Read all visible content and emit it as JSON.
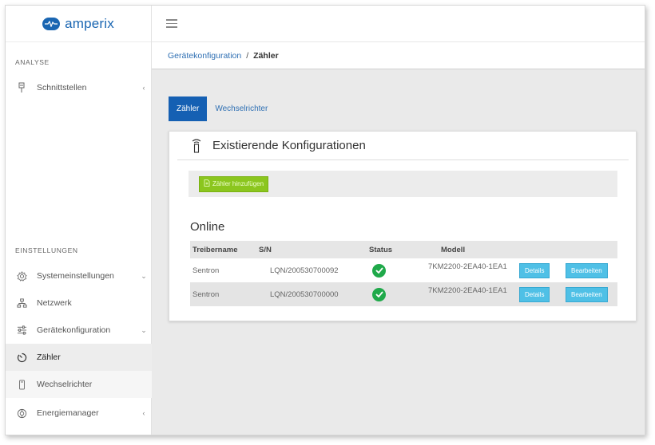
{
  "brand": {
    "name": "amperix"
  },
  "sidebar": {
    "analyse_label": "ANALYSE",
    "settings_label": "EINSTELLUNGEN",
    "items": [
      {
        "label": "Schnittstellen",
        "icon": "plug-icon",
        "chevron": "‹"
      },
      {
        "label": "Systemeinstellungen",
        "icon": "gear-icon",
        "chevron": "⌄"
      },
      {
        "label": "Netzwerk",
        "icon": "network-icon"
      },
      {
        "label": "Gerätekonfiguration",
        "icon": "sliders-icon",
        "chevron": "⌄"
      },
      {
        "label": "Zähler",
        "icon": "meter-icon"
      },
      {
        "label": "Wechselrichter",
        "icon": "inverter-icon"
      },
      {
        "label": "Energiemanager",
        "icon": "energy-manager-icon",
        "chevron": "‹"
      }
    ]
  },
  "breadcrumb": {
    "parent": "Gerätekonfiguration",
    "separator": "/",
    "current": "Zähler"
  },
  "tabs": [
    {
      "label": "Zähler",
      "active": true
    },
    {
      "label": "Wechselrichter",
      "active": false
    }
  ],
  "card": {
    "title": "Existierende Konfigurationen",
    "add_button_label": "Zähler hinzufügen",
    "section_title": "Online",
    "table": {
      "columns": [
        "Treibername",
        "S/N",
        "Status",
        "Modell"
      ],
      "rows": [
        {
          "driver": "Sentron",
          "sn": "LQN/200530700092",
          "status": "ok",
          "model": "7KM2200-2EA40-1EA1",
          "details": "Details",
          "edit": "Bearbeiten"
        },
        {
          "driver": "Sentron",
          "sn": "LQN/200530700000",
          "status": "ok",
          "model": "7KM2200-2EA40-1EA1",
          "details": "Details",
          "edit": "Bearbeiten"
        }
      ]
    }
  },
  "colors": {
    "primary": "#1560b3",
    "success": "#1fa94a",
    "add_button": "#8bc61e",
    "info_button": "#4fc0e6"
  }
}
